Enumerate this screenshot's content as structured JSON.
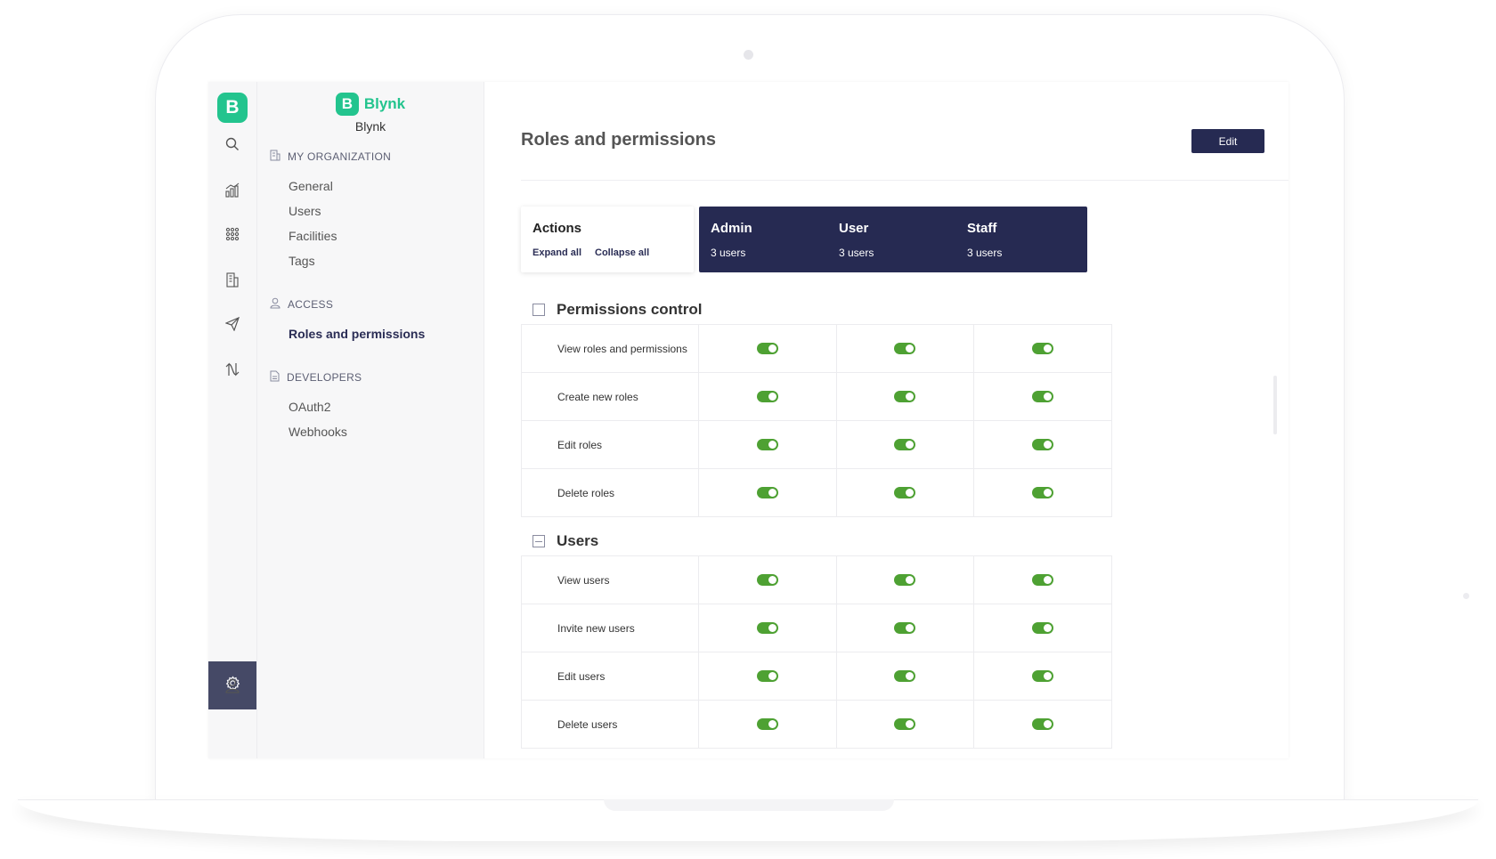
{
  "app": {
    "logo_letter": "B",
    "brand": "Blynk",
    "org_name": "Blynk",
    "accent": "#23c48e",
    "navy": "#262a52",
    "toggle_on": "#4ea133"
  },
  "rail": {
    "icons": [
      "search-icon",
      "analytics-icon",
      "apps-grid-icon",
      "organization-icon",
      "send-icon",
      "integrations-icon",
      "settings-icon",
      "user-profile-icon"
    ]
  },
  "sidebar": {
    "sections": [
      {
        "title": "MY ORGANIZATION",
        "icon": "building-icon",
        "items": [
          "General",
          "Users",
          "Facilities",
          "Tags"
        ]
      },
      {
        "title": "ACCESS",
        "icon": "user-icon",
        "items": [
          "Roles and permissions"
        ]
      },
      {
        "title": "DEVELOPERS",
        "icon": "document-icon",
        "items": [
          "OAuth2",
          "Webhooks"
        ]
      }
    ]
  },
  "main": {
    "title": "Roles and permissions",
    "edit_label": "Edit",
    "actions": {
      "title": "Actions",
      "expand_all": "Expand all",
      "collapse_all": "Collapse all"
    },
    "roles": [
      {
        "name": "Admin",
        "count": "3 users"
      },
      {
        "name": "User",
        "count": "3 users"
      },
      {
        "name": "Staff",
        "count": "3 users"
      }
    ],
    "groups": [
      {
        "title": "Permissions control",
        "rows": [
          {
            "label": "View roles and permissions",
            "admin": true,
            "user": true,
            "staff": true
          },
          {
            "label": "Create new roles",
            "admin": true,
            "user": true,
            "staff": true
          },
          {
            "label": "Edit roles",
            "admin": true,
            "user": true,
            "staff": true
          },
          {
            "label": "Delete roles",
            "admin": true,
            "user": true,
            "staff": true
          }
        ]
      },
      {
        "title": "Users",
        "rows": [
          {
            "label": "View users",
            "admin": true,
            "user": true,
            "staff": true
          },
          {
            "label": "Invite new users",
            "admin": true,
            "user": true,
            "staff": true
          },
          {
            "label": "Edit users",
            "admin": true,
            "user": true,
            "staff": true
          },
          {
            "label": "Delete users",
            "admin": true,
            "user": true,
            "staff": true
          }
        ]
      }
    ]
  }
}
